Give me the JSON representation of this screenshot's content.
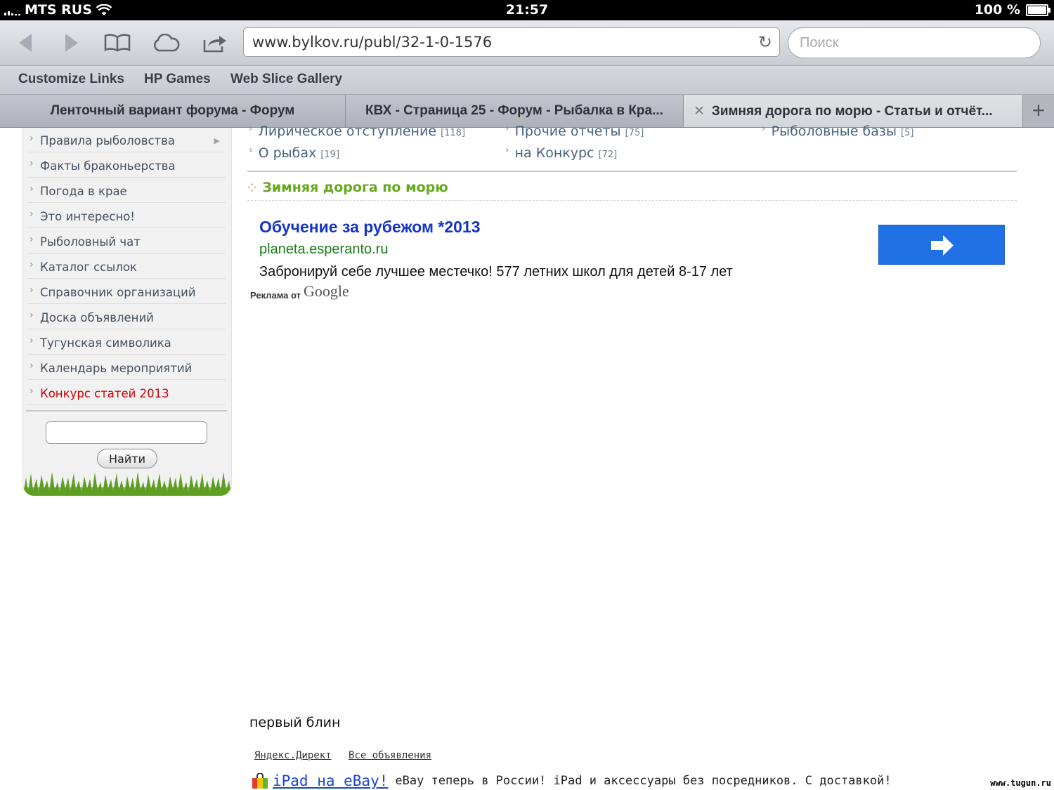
{
  "status": {
    "carrier": "MTS RUS",
    "time": "21:57",
    "battery": "100 %"
  },
  "toolbar": {
    "url": "www.bylkov.ru/publ/32-1-0-1576",
    "search_placeholder": "Поиск"
  },
  "bookmarks": [
    "Customize Links",
    "HP Games",
    "Web Slice Gallery"
  ],
  "tabs": [
    {
      "label": "Ленточный вариант форума - Форум"
    },
    {
      "label": "КВХ - Страница 25 - Форум - Рыбалка в Кра..."
    },
    {
      "label": "Зимняя дорога по морю - Статьи и отчёт..."
    }
  ],
  "sidebar": {
    "items": [
      "Правила рыболовства",
      "Факты браконьерства",
      "Погода в крае",
      "Это интересно!",
      "Рыболовный чат",
      "Каталог ссылок",
      "Справочник организаций",
      "Доска объявлений",
      "Тугунская символика",
      "Календарь мероприятий",
      "Конкурс статей 2013"
    ],
    "search_button": "Найти"
  },
  "categories": [
    {
      "name": "Лирическое отступление",
      "count": "[118]"
    },
    {
      "name": "Прочие отчеты",
      "count": "[75]"
    },
    {
      "name": "Рыболовные базы",
      "count": "[5]"
    },
    {
      "name": "О рыбах",
      "count": "[19]"
    },
    {
      "name": "на Конкурс",
      "count": "[72]"
    }
  ],
  "section_title": "Зимняя дорога по морю",
  "ad": {
    "title": "Обучение за рубежом *2013",
    "url": "planeta.esperanto.ru",
    "text": "Забронируй себе лучшее местечко! 577 летних школ для детей 8-17 лет",
    "from": "Реклама от",
    "brand": "Google"
  },
  "article_text": "первый блин",
  "yandex": {
    "links": [
      "Яндекс.Директ",
      "Все объявления"
    ],
    "ad_link": "iPad на eBay!",
    "ad_text": "eBay теперь в России! iPad и аксессуары без посредников. С доставкой!"
  },
  "watermark": "www.tugun.ru"
}
